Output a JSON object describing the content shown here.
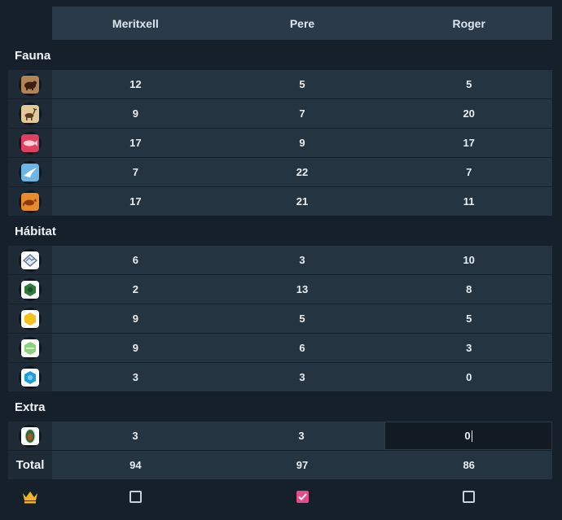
{
  "players": [
    "Meritxell",
    "Pere",
    "Roger"
  ],
  "sections": [
    {
      "title": "Fauna",
      "rows": [
        {
          "icon": "bear-icon",
          "color": "#6b3b2a",
          "values": [
            "12",
            "5",
            "5"
          ]
        },
        {
          "icon": "elk-icon",
          "color": "#c9a46a",
          "values": [
            "9",
            "7",
            "20"
          ]
        },
        {
          "icon": "salmon-icon",
          "color": "#e04060",
          "values": [
            "17",
            "9",
            "17"
          ]
        },
        {
          "icon": "hawk-icon",
          "color": "#6cb6e6",
          "values": [
            "7",
            "22",
            "7"
          ]
        },
        {
          "icon": "fox-icon",
          "color": "#e98a2c",
          "values": [
            "17",
            "21",
            "11"
          ]
        }
      ]
    },
    {
      "title": "Hábitat",
      "rows": [
        {
          "icon": "mountain-icon",
          "color": "#9fb4d8",
          "values": [
            "6",
            "3",
            "10"
          ]
        },
        {
          "icon": "forest-icon",
          "color": "#2f7a3a",
          "values": [
            "2",
            "13",
            "8"
          ]
        },
        {
          "icon": "prairie-icon",
          "color": "#f2c21b",
          "values": [
            "9",
            "5",
            "5"
          ]
        },
        {
          "icon": "wetland-icon",
          "color": "#8fd07a",
          "values": [
            "9",
            "6",
            "3"
          ]
        },
        {
          "icon": "river-icon",
          "color": "#1f9ed8",
          "values": [
            "3",
            "3",
            "0"
          ]
        }
      ]
    },
    {
      "title": "Extra",
      "rows": [
        {
          "icon": "pinecone-icon",
          "color": "#2d6b3a",
          "values": [
            "3",
            "3",
            "0"
          ]
        }
      ]
    }
  ],
  "total": {
    "label": "Total",
    "values": [
      "94",
      "97",
      "86"
    ]
  },
  "winner": {
    "icon": "crown-icon",
    "crown_color": "#f0b429",
    "checked": [
      false,
      true,
      false
    ]
  }
}
